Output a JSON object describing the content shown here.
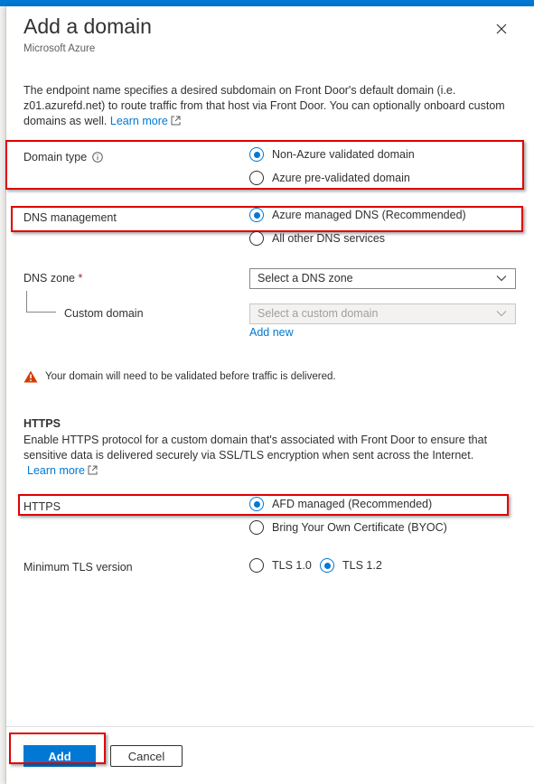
{
  "header": {
    "title": "Add a domain",
    "subtitle": "Microsoft Azure",
    "close_icon": "close-icon"
  },
  "description": {
    "text": "The endpoint name specifies a desired subdomain on Front Door's default domain (i.e. z01.azurefd.net) to route traffic from that host via Front Door. You can optionally onboard custom domains as well.",
    "learn_more": "Learn more"
  },
  "domain_type": {
    "label": "Domain type",
    "info_icon": "info-icon",
    "options": [
      {
        "label": "Non-Azure validated domain",
        "checked": true
      },
      {
        "label": "Azure pre-validated domain",
        "checked": false
      }
    ]
  },
  "dns_management": {
    "label": "DNS management",
    "options": [
      {
        "label": "Azure managed DNS (Recommended)",
        "checked": true
      },
      {
        "label": "All other DNS services",
        "checked": false
      }
    ]
  },
  "dns_zone": {
    "label": "DNS zone",
    "required_marker": "*",
    "placeholder": "Select a DNS zone"
  },
  "custom_domain": {
    "label": "Custom domain",
    "placeholder": "Select a custom domain",
    "disabled": true,
    "add_new": "Add new"
  },
  "warning": {
    "icon": "warning-icon",
    "text": "Your domain will need to be validated before traffic is delivered."
  },
  "https_section": {
    "title": "HTTPS",
    "description": "Enable HTTPS protocol for a custom domain that's associated with Front Door to ensure that sensitive data is delivered securely via SSL/TLS encryption when sent across the Internet.",
    "learn_more": "Learn more"
  },
  "https": {
    "label": "HTTPS",
    "options": [
      {
        "label": "AFD managed (Recommended)",
        "checked": true
      },
      {
        "label": "Bring Your Own Certificate (BYOC)",
        "checked": false
      }
    ]
  },
  "tls": {
    "label": "Minimum TLS version",
    "options": [
      {
        "label": "TLS 1.0",
        "checked": false
      },
      {
        "label": "TLS 1.2",
        "checked": true
      }
    ]
  },
  "footer": {
    "add_label": "Add",
    "cancel_label": "Cancel"
  },
  "colors": {
    "accent": "#0078d4",
    "annotation_red": "#e00000",
    "warning": "#d83b01"
  }
}
